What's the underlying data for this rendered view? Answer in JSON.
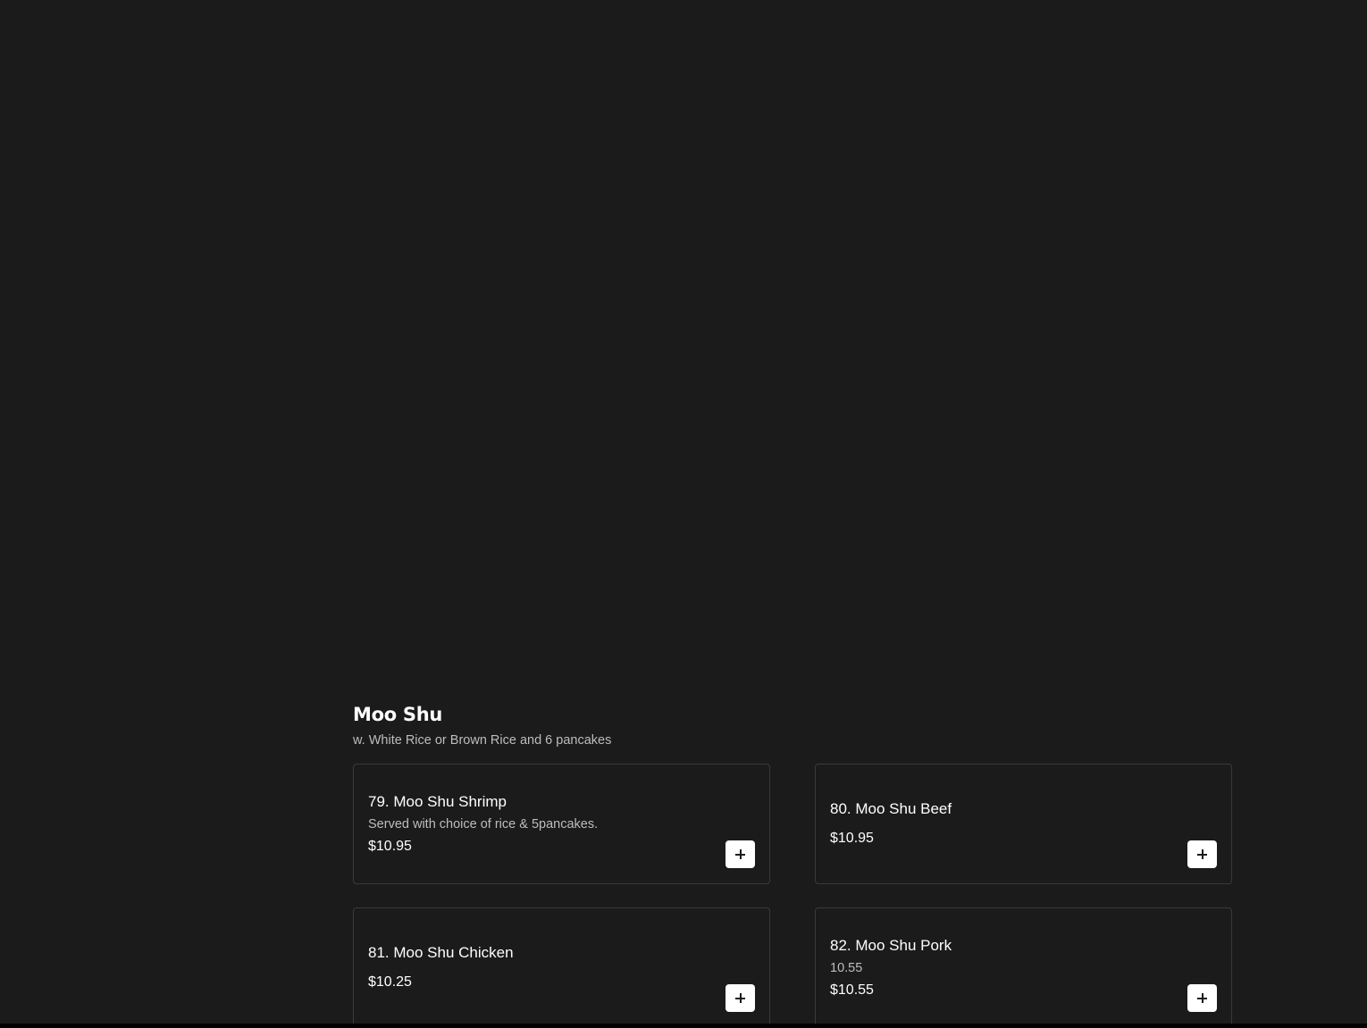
{
  "section": {
    "title": "Moo Shu",
    "subtitle": "w. White Rice or Brown Rice and 6 pancakes"
  },
  "items": [
    {
      "name": "79. Moo Shu Shrimp",
      "description": "Served with choice of rice & 5pancakes.",
      "price": "$10.95"
    },
    {
      "name": "80. Moo Shu Beef",
      "description": "",
      "price": "$10.95"
    },
    {
      "name": "81. Moo Shu Chicken",
      "description": "",
      "price": "$10.25"
    },
    {
      "name": "82. Moo Shu Pork",
      "description": "10.55",
      "price": "$10.55"
    }
  ],
  "icons": {
    "add": "plus-icon"
  }
}
